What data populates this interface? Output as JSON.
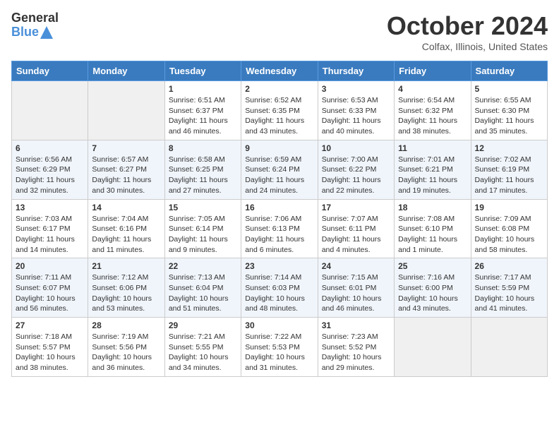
{
  "header": {
    "logo_general": "General",
    "logo_blue": "Blue",
    "month_title": "October 2024",
    "location": "Colfax, Illinois, United States"
  },
  "days_of_week": [
    "Sunday",
    "Monday",
    "Tuesday",
    "Wednesday",
    "Thursday",
    "Friday",
    "Saturday"
  ],
  "weeks": [
    [
      {
        "day": "",
        "info": ""
      },
      {
        "day": "",
        "info": ""
      },
      {
        "day": "1",
        "info": "Sunrise: 6:51 AM\nSunset: 6:37 PM\nDaylight: 11 hours and 46 minutes."
      },
      {
        "day": "2",
        "info": "Sunrise: 6:52 AM\nSunset: 6:35 PM\nDaylight: 11 hours and 43 minutes."
      },
      {
        "day": "3",
        "info": "Sunrise: 6:53 AM\nSunset: 6:33 PM\nDaylight: 11 hours and 40 minutes."
      },
      {
        "day": "4",
        "info": "Sunrise: 6:54 AM\nSunset: 6:32 PM\nDaylight: 11 hours and 38 minutes."
      },
      {
        "day": "5",
        "info": "Sunrise: 6:55 AM\nSunset: 6:30 PM\nDaylight: 11 hours and 35 minutes."
      }
    ],
    [
      {
        "day": "6",
        "info": "Sunrise: 6:56 AM\nSunset: 6:29 PM\nDaylight: 11 hours and 32 minutes."
      },
      {
        "day": "7",
        "info": "Sunrise: 6:57 AM\nSunset: 6:27 PM\nDaylight: 11 hours and 30 minutes."
      },
      {
        "day": "8",
        "info": "Sunrise: 6:58 AM\nSunset: 6:25 PM\nDaylight: 11 hours and 27 minutes."
      },
      {
        "day": "9",
        "info": "Sunrise: 6:59 AM\nSunset: 6:24 PM\nDaylight: 11 hours and 24 minutes."
      },
      {
        "day": "10",
        "info": "Sunrise: 7:00 AM\nSunset: 6:22 PM\nDaylight: 11 hours and 22 minutes."
      },
      {
        "day": "11",
        "info": "Sunrise: 7:01 AM\nSunset: 6:21 PM\nDaylight: 11 hours and 19 minutes."
      },
      {
        "day": "12",
        "info": "Sunrise: 7:02 AM\nSunset: 6:19 PM\nDaylight: 11 hours and 17 minutes."
      }
    ],
    [
      {
        "day": "13",
        "info": "Sunrise: 7:03 AM\nSunset: 6:17 PM\nDaylight: 11 hours and 14 minutes."
      },
      {
        "day": "14",
        "info": "Sunrise: 7:04 AM\nSunset: 6:16 PM\nDaylight: 11 hours and 11 minutes."
      },
      {
        "day": "15",
        "info": "Sunrise: 7:05 AM\nSunset: 6:14 PM\nDaylight: 11 hours and 9 minutes."
      },
      {
        "day": "16",
        "info": "Sunrise: 7:06 AM\nSunset: 6:13 PM\nDaylight: 11 hours and 6 minutes."
      },
      {
        "day": "17",
        "info": "Sunrise: 7:07 AM\nSunset: 6:11 PM\nDaylight: 11 hours and 4 minutes."
      },
      {
        "day": "18",
        "info": "Sunrise: 7:08 AM\nSunset: 6:10 PM\nDaylight: 11 hours and 1 minute."
      },
      {
        "day": "19",
        "info": "Sunrise: 7:09 AM\nSunset: 6:08 PM\nDaylight: 10 hours and 58 minutes."
      }
    ],
    [
      {
        "day": "20",
        "info": "Sunrise: 7:11 AM\nSunset: 6:07 PM\nDaylight: 10 hours and 56 minutes."
      },
      {
        "day": "21",
        "info": "Sunrise: 7:12 AM\nSunset: 6:06 PM\nDaylight: 10 hours and 53 minutes."
      },
      {
        "day": "22",
        "info": "Sunrise: 7:13 AM\nSunset: 6:04 PM\nDaylight: 10 hours and 51 minutes."
      },
      {
        "day": "23",
        "info": "Sunrise: 7:14 AM\nSunset: 6:03 PM\nDaylight: 10 hours and 48 minutes."
      },
      {
        "day": "24",
        "info": "Sunrise: 7:15 AM\nSunset: 6:01 PM\nDaylight: 10 hours and 46 minutes."
      },
      {
        "day": "25",
        "info": "Sunrise: 7:16 AM\nSunset: 6:00 PM\nDaylight: 10 hours and 43 minutes."
      },
      {
        "day": "26",
        "info": "Sunrise: 7:17 AM\nSunset: 5:59 PM\nDaylight: 10 hours and 41 minutes."
      }
    ],
    [
      {
        "day": "27",
        "info": "Sunrise: 7:18 AM\nSunset: 5:57 PM\nDaylight: 10 hours and 38 minutes."
      },
      {
        "day": "28",
        "info": "Sunrise: 7:19 AM\nSunset: 5:56 PM\nDaylight: 10 hours and 36 minutes."
      },
      {
        "day": "29",
        "info": "Sunrise: 7:21 AM\nSunset: 5:55 PM\nDaylight: 10 hours and 34 minutes."
      },
      {
        "day": "30",
        "info": "Sunrise: 7:22 AM\nSunset: 5:53 PM\nDaylight: 10 hours and 31 minutes."
      },
      {
        "day": "31",
        "info": "Sunrise: 7:23 AM\nSunset: 5:52 PM\nDaylight: 10 hours and 29 minutes."
      },
      {
        "day": "",
        "info": ""
      },
      {
        "day": "",
        "info": ""
      }
    ]
  ]
}
